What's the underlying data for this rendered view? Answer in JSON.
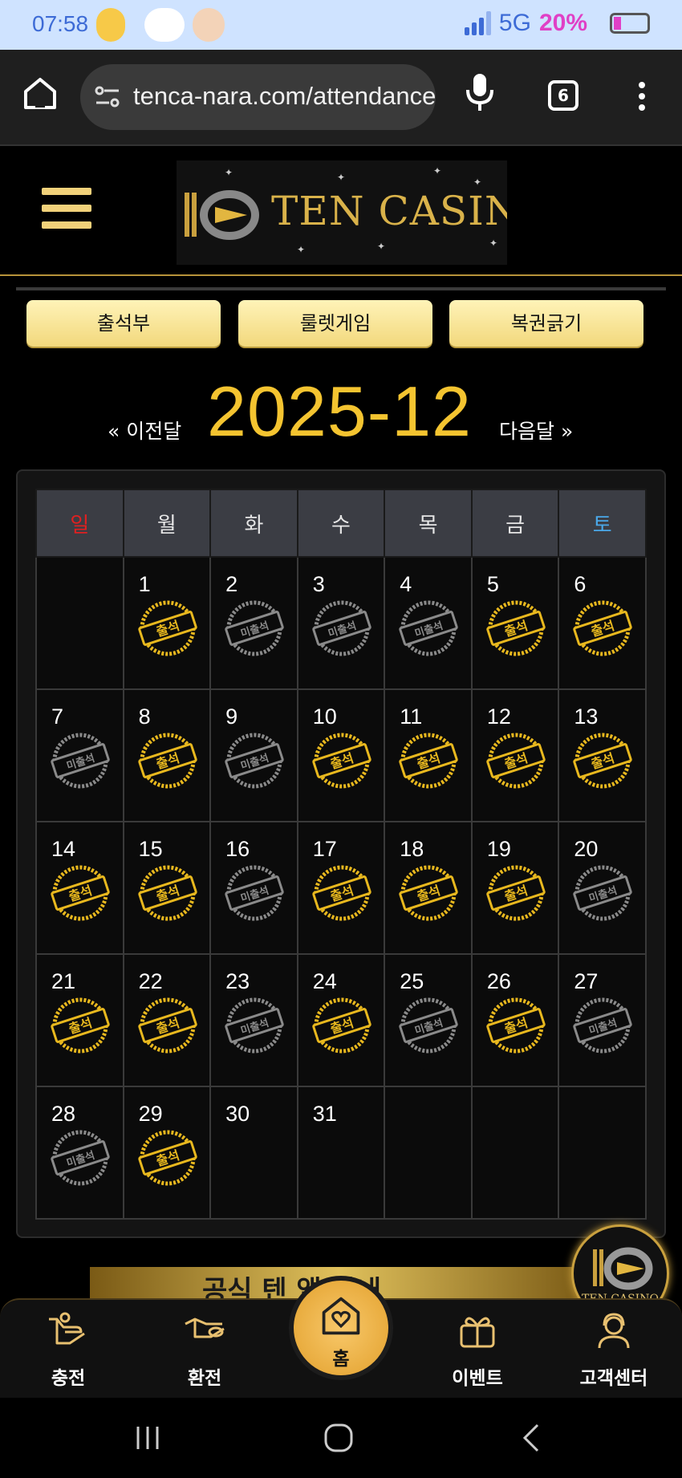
{
  "status_bar": {
    "time": "07:58",
    "network": "5G",
    "battery": "20%"
  },
  "browser": {
    "url": "tenca-nara.com/attendance",
    "tab_count": "6"
  },
  "site": {
    "logo_text": "TEN CASINO"
  },
  "top_buttons": [
    "출석부",
    "룰렛게임",
    "복권긁기"
  ],
  "month_nav": {
    "prev_label": "« 이전달",
    "title": "2025-12",
    "next_label": "다음달 »"
  },
  "calendar": {
    "weekdays": [
      "일",
      "월",
      "화",
      "수",
      "목",
      "금",
      "토"
    ],
    "attended_label": "출석",
    "absent_label": "미출석",
    "weeks": [
      [
        {
          "day": "",
          "status": ""
        },
        {
          "day": "1",
          "status": "attended"
        },
        {
          "day": "2",
          "status": "absent"
        },
        {
          "day": "3",
          "status": "absent"
        },
        {
          "day": "4",
          "status": "absent"
        },
        {
          "day": "5",
          "status": "attended"
        },
        {
          "day": "6",
          "status": "attended"
        }
      ],
      [
        {
          "day": "7",
          "status": "absent"
        },
        {
          "day": "8",
          "status": "attended"
        },
        {
          "day": "9",
          "status": "absent"
        },
        {
          "day": "10",
          "status": "attended"
        },
        {
          "day": "11",
          "status": "attended"
        },
        {
          "day": "12",
          "status": "attended"
        },
        {
          "day": "13",
          "status": "attended"
        }
      ],
      [
        {
          "day": "14",
          "status": "attended"
        },
        {
          "day": "15",
          "status": "attended"
        },
        {
          "day": "16",
          "status": "absent"
        },
        {
          "day": "17",
          "status": "attended"
        },
        {
          "day": "18",
          "status": "attended"
        },
        {
          "day": "19",
          "status": "attended"
        },
        {
          "day": "20",
          "status": "absent"
        }
      ],
      [
        {
          "day": "21",
          "status": "attended"
        },
        {
          "day": "22",
          "status": "attended"
        },
        {
          "day": "23",
          "status": "absent"
        },
        {
          "day": "24",
          "status": "attended"
        },
        {
          "day": "25",
          "status": "absent"
        },
        {
          "day": "26",
          "status": "attended"
        },
        {
          "day": "27",
          "status": "absent"
        }
      ],
      [
        {
          "day": "28",
          "status": "absent"
        },
        {
          "day": "29",
          "status": "attended"
        },
        {
          "day": "30",
          "status": ""
        },
        {
          "day": "31",
          "status": ""
        },
        {
          "day": "",
          "status": ""
        },
        {
          "day": "",
          "status": ""
        },
        {
          "day": "",
          "status": ""
        }
      ]
    ]
  },
  "banner": {
    "text": "공식 텐 앱 안내"
  },
  "bottom_nav": {
    "charge": "충전",
    "exchange": "환전",
    "home": "홈",
    "event": "이벤트",
    "support": "고객센터"
  },
  "colors": {
    "gold": "#f4c430",
    "attended_stamp": "#e8b81e",
    "absent_stamp": "#8a8a8a",
    "sunday": "#e02020",
    "saturday": "#4aa8e8"
  }
}
